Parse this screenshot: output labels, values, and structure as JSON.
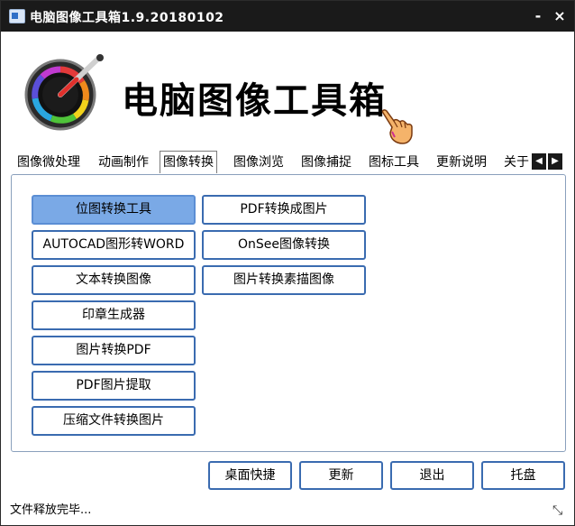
{
  "window": {
    "title": "电脑图像工具箱1.9.20180102",
    "minimize_label": "-",
    "close_label": "×"
  },
  "header": {
    "title": "电脑图像工具箱"
  },
  "tabs": [
    {
      "label": "图像微处理",
      "active": false
    },
    {
      "label": "动画制作",
      "active": false
    },
    {
      "label": "图像转换",
      "active": true
    },
    {
      "label": "图像浏览",
      "active": false
    },
    {
      "label": "图像捕捉",
      "active": false
    },
    {
      "label": "图标工具",
      "active": false
    },
    {
      "label": "更新说明",
      "active": false
    },
    {
      "label": "关于",
      "active": false
    }
  ],
  "tab_scroll": {
    "left": "◀",
    "right": "▶"
  },
  "tools": {
    "col1": [
      "位图转换工具",
      "AUTOCAD图形转WORD",
      "文本转换图像",
      "印章生成器",
      "图片转换PDF",
      "PDF图片提取",
      "压缩文件转换图片"
    ],
    "col2": [
      "PDF转换成图片",
      "OnSee图像转换",
      "图片转换素描图像"
    ],
    "selected": "位图转换工具"
  },
  "bottom_buttons": [
    "桌面快捷",
    "更新",
    "退出",
    "托盘"
  ],
  "status": {
    "text": "文件释放完毕...",
    "grip": "⤡"
  },
  "colors": {
    "titlebar": "#1a1a1a",
    "button_border": "#3a6bb0",
    "selected_fill": "#7aa9e6",
    "panel_border": "#8aa0bc"
  },
  "icons": [
    "app-icon",
    "color-picker-dial-icon",
    "pointing-hand-icon",
    "resize-grip-icon"
  ]
}
